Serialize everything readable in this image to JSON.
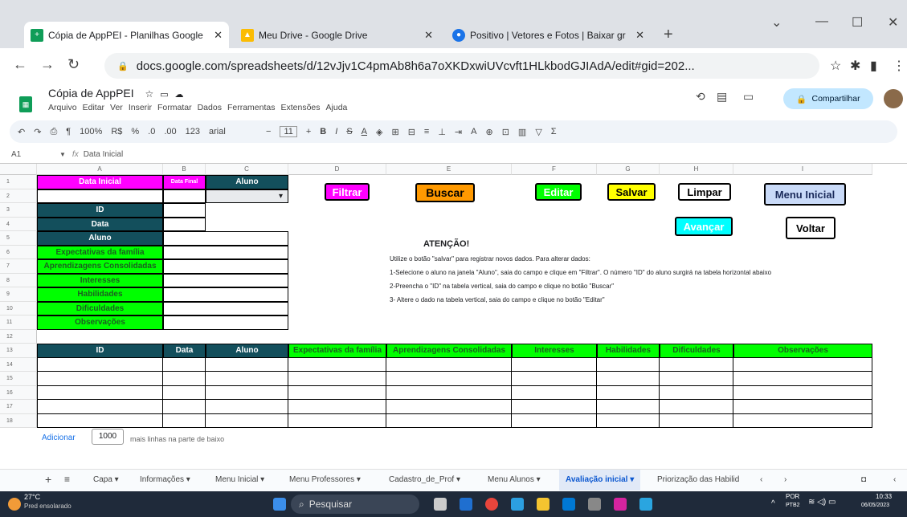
{
  "browser": {
    "tabs": [
      {
        "title": "Cópia de AppPEI - Planilhas Google"
      },
      {
        "title": "Meu Drive - Google Drive"
      },
      {
        "title": "Positivo | Vetores e Fotos | Baixar gr"
      }
    ],
    "url": "docs.google.com/spreadsheets/d/12vJjv1C4pmAb8h6a7oXKDxwiUVcvft1HLkbodGJIAdA/edit#gid=202..."
  },
  "doc": {
    "title": "Cópia de AppPEI",
    "menus": [
      "Arquivo",
      "Editar",
      "Ver",
      "Inserir",
      "Formatar",
      "Dados",
      "Ferramentas",
      "Extensões",
      "Ajuda"
    ],
    "share_label": "Compartilhar"
  },
  "toolbar": {
    "zoom": "100%",
    "currency": "R$",
    "percent": "%",
    "dec_down": ".0",
    "dec_up": ".00",
    "format123": "123",
    "font": "arial",
    "font_size": "11"
  },
  "formula_bar": {
    "cell_ref": "A1",
    "fx": "fx",
    "content": "Data Inicial"
  },
  "columns": [
    "A",
    "B",
    "C",
    "D",
    "E",
    "F",
    "G",
    "H",
    "I"
  ],
  "rows": [
    "1",
    "2",
    "3",
    "4",
    "5",
    "6",
    "7",
    "8",
    "9",
    "10",
    "11",
    "12",
    "13",
    "14",
    "15",
    "16",
    "17",
    "18"
  ],
  "sheet": {
    "data_inicial": "Data Inicial",
    "data_final": "Data Final",
    "aluno": "Aluno",
    "vertical_labels": [
      "ID",
      "Data",
      "Aluno",
      "Expectativas da família",
      "Aprendizagens Consolidadas",
      "Interesses",
      "Habilidades",
      "Dificuldades",
      "Observações"
    ],
    "table_headers": [
      "ID",
      "Data",
      "Aluno",
      "Expectativas da família",
      "Aprendizagens Consolidadas",
      "Interesses",
      "Habilidades",
      "Dificuldades",
      "Observações"
    ],
    "buttons": {
      "filtrar": "Filtrar",
      "buscar": "Buscar",
      "editar": "Editar",
      "salvar": "Salvar",
      "limpar": "Limpar",
      "menu_inicial": "Menu Inicial",
      "avancar": "Avançar",
      "voltar": "Voltar"
    },
    "attention_title": "ATENÇÃO!",
    "notes": [
      "Utilize o botão \"salvar\" para registrar novos dados. Para alterar dados:",
      "1-Selecione o aluno na janela \"Aluno\", saia do campo e clique em \"Filtrar\". O número \"ID\" do aluno surgirá na tabela horizontal abaixo",
      "2-Preencha o \"ID\" na tabela vertical, saia do campo e clique no botão \"Buscar\"",
      "3- Altere o dado na tabela vertical, saia do campo e clique no botão \"Editar\""
    ]
  },
  "add_rows": {
    "label": "Adicionar",
    "count": "1000",
    "suffix": "mais linhas na parte de baixo"
  },
  "sheet_tabs": [
    "Capa",
    "Informações",
    "Menu Inicial",
    "Menu Professores",
    "Cadastro_de_Prof",
    "Menu Alunos",
    "Avaliação inicial",
    "Priorização das Habilid"
  ],
  "active_sheet_tab": "Avaliação inicial",
  "taskbar": {
    "temp": "27°C",
    "weather": "Pred ensolarado",
    "search": "Pesquisar",
    "lang": "POR",
    "lang2": "PTB2",
    "time": "10:33",
    "date": "06/05/2023"
  },
  "colors": {
    "pink": "#ff00ff",
    "dark_teal": "#134f5c",
    "green": "#00ff00",
    "orange": "#ff9900",
    "yellow": "#ffff00",
    "light_blue": "#c9daf8",
    "cyan": "#00ffff"
  }
}
